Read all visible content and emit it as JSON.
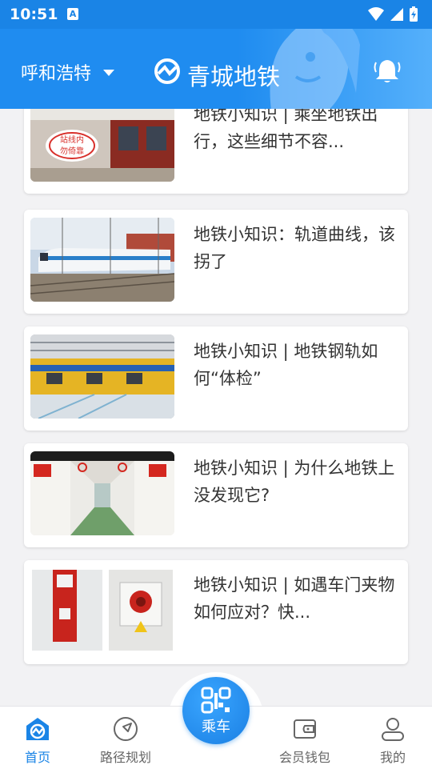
{
  "status_bar": {
    "time": "10:51",
    "a_badge": "A"
  },
  "header": {
    "city": "呼和浩特",
    "app_title": "青城地铁"
  },
  "articles": [
    {
      "title": "地铁小知识 | 乘坐地铁出行，这些细节不容...",
      "image_text": "站线内\n勿倚靠"
    },
    {
      "title": "地铁小知识：轨道曲线，该拐了"
    },
    {
      "title": "地铁小知识 | 地铁钢轨如何“体检”"
    },
    {
      "title": "地铁小知识 | 为什么地铁上没发现它?"
    },
    {
      "title": "地铁小知识 | 如遇车门夹物如何应对？快..."
    }
  ],
  "tabbar": {
    "home": "首页",
    "route": "路径规划",
    "ride": "乘车",
    "wallet": "会员钱包",
    "mine": "我的"
  },
  "colors": {
    "accent": "#1a84e6",
    "tab_inactive": "#666666"
  }
}
